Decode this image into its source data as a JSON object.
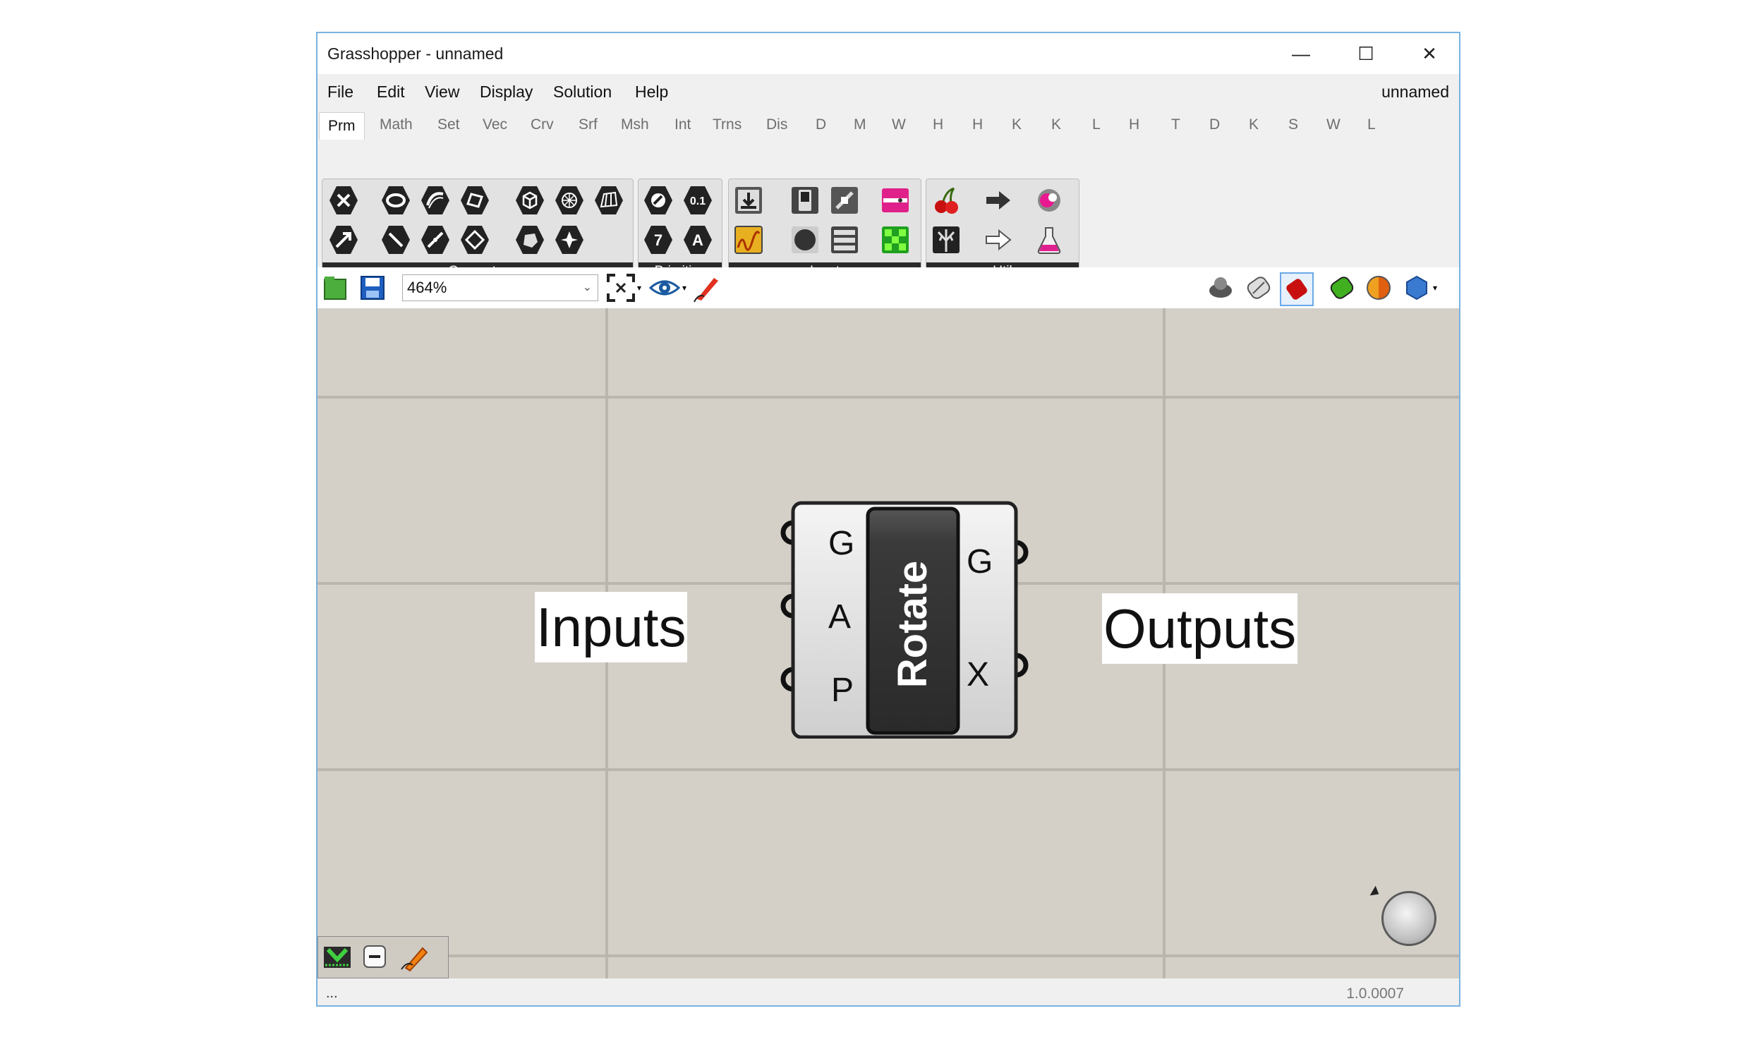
{
  "window": {
    "title": "Grasshopper - unnamed",
    "minimize": "—",
    "maximize": "☐",
    "close": "✕"
  },
  "menu": {
    "items": [
      "File",
      "Edit",
      "View",
      "Display",
      "Solution",
      "Help"
    ],
    "document_name": "unnamed"
  },
  "tabs": [
    "Prm",
    "Math",
    "Set",
    "Vec",
    "Crv",
    "Srf",
    "Msh",
    "Int",
    "Trns",
    "Dis",
    "D",
    "M",
    "W",
    "H",
    "H",
    "K",
    "K",
    "L",
    "H",
    "T",
    "D",
    "K",
    "S",
    "W",
    "L"
  ],
  "active_tab": "Prm",
  "ribbon": {
    "panels": [
      "Geometry",
      "Primitive",
      "Input",
      "Util"
    ],
    "expand": "+",
    "primitive_number_icon": "0.1",
    "primitive_integer_icon": "7",
    "primitive_text_icon": "A"
  },
  "toolbar": {
    "zoom": "464%"
  },
  "canvas": {
    "inputs_label": "Inputs",
    "outputs_label": "Outputs"
  },
  "component": {
    "name": "Rotate",
    "inputs": [
      "G",
      "A",
      "P"
    ],
    "outputs": [
      "G",
      "X"
    ]
  },
  "status": {
    "left": "...",
    "version": "1.0.0007"
  },
  "colors": {
    "canvas": "#d4d0c8",
    "grid": "#bab6ae",
    "panel_label": "#2a2a2a",
    "component_body": "#e4e4e4",
    "component_name_bg": "#3a3a3a",
    "window_border": "#7ab2e0"
  }
}
